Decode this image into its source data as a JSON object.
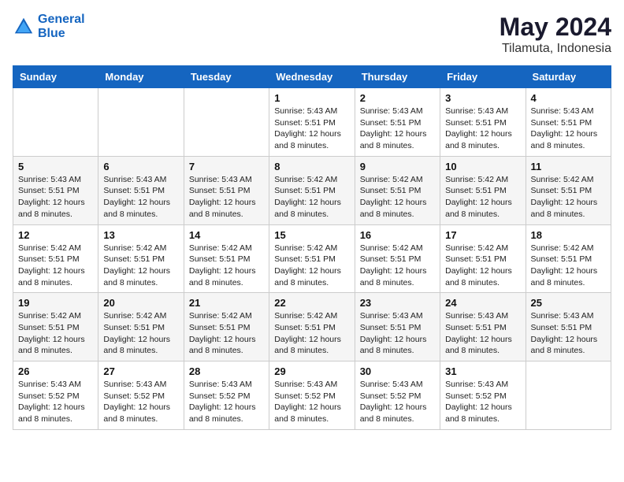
{
  "header": {
    "logo_line1": "General",
    "logo_line2": "Blue",
    "month": "May 2024",
    "location": "Tilamuta, Indonesia"
  },
  "weekdays": [
    "Sunday",
    "Monday",
    "Tuesday",
    "Wednesday",
    "Thursday",
    "Friday",
    "Saturday"
  ],
  "weeks": [
    [
      {
        "day": "",
        "info": ""
      },
      {
        "day": "",
        "info": ""
      },
      {
        "day": "",
        "info": ""
      },
      {
        "day": "1",
        "info": "Sunrise: 5:43 AM\nSunset: 5:51 PM\nDaylight: 12 hours\nand 8 minutes."
      },
      {
        "day": "2",
        "info": "Sunrise: 5:43 AM\nSunset: 5:51 PM\nDaylight: 12 hours\nand 8 minutes."
      },
      {
        "day": "3",
        "info": "Sunrise: 5:43 AM\nSunset: 5:51 PM\nDaylight: 12 hours\nand 8 minutes."
      },
      {
        "day": "4",
        "info": "Sunrise: 5:43 AM\nSunset: 5:51 PM\nDaylight: 12 hours\nand 8 minutes."
      }
    ],
    [
      {
        "day": "5",
        "info": "Sunrise: 5:43 AM\nSunset: 5:51 PM\nDaylight: 12 hours\nand 8 minutes."
      },
      {
        "day": "6",
        "info": "Sunrise: 5:43 AM\nSunset: 5:51 PM\nDaylight: 12 hours\nand 8 minutes."
      },
      {
        "day": "7",
        "info": "Sunrise: 5:43 AM\nSunset: 5:51 PM\nDaylight: 12 hours\nand 8 minutes."
      },
      {
        "day": "8",
        "info": "Sunrise: 5:42 AM\nSunset: 5:51 PM\nDaylight: 12 hours\nand 8 minutes."
      },
      {
        "day": "9",
        "info": "Sunrise: 5:42 AM\nSunset: 5:51 PM\nDaylight: 12 hours\nand 8 minutes."
      },
      {
        "day": "10",
        "info": "Sunrise: 5:42 AM\nSunset: 5:51 PM\nDaylight: 12 hours\nand 8 minutes."
      },
      {
        "day": "11",
        "info": "Sunrise: 5:42 AM\nSunset: 5:51 PM\nDaylight: 12 hours\nand 8 minutes."
      }
    ],
    [
      {
        "day": "12",
        "info": "Sunrise: 5:42 AM\nSunset: 5:51 PM\nDaylight: 12 hours\nand 8 minutes."
      },
      {
        "day": "13",
        "info": "Sunrise: 5:42 AM\nSunset: 5:51 PM\nDaylight: 12 hours\nand 8 minutes."
      },
      {
        "day": "14",
        "info": "Sunrise: 5:42 AM\nSunset: 5:51 PM\nDaylight: 12 hours\nand 8 minutes."
      },
      {
        "day": "15",
        "info": "Sunrise: 5:42 AM\nSunset: 5:51 PM\nDaylight: 12 hours\nand 8 minutes."
      },
      {
        "day": "16",
        "info": "Sunrise: 5:42 AM\nSunset: 5:51 PM\nDaylight: 12 hours\nand 8 minutes."
      },
      {
        "day": "17",
        "info": "Sunrise: 5:42 AM\nSunset: 5:51 PM\nDaylight: 12 hours\nand 8 minutes."
      },
      {
        "day": "18",
        "info": "Sunrise: 5:42 AM\nSunset: 5:51 PM\nDaylight: 12 hours\nand 8 minutes."
      }
    ],
    [
      {
        "day": "19",
        "info": "Sunrise: 5:42 AM\nSunset: 5:51 PM\nDaylight: 12 hours\nand 8 minutes."
      },
      {
        "day": "20",
        "info": "Sunrise: 5:42 AM\nSunset: 5:51 PM\nDaylight: 12 hours\nand 8 minutes."
      },
      {
        "day": "21",
        "info": "Sunrise: 5:42 AM\nSunset: 5:51 PM\nDaylight: 12 hours\nand 8 minutes."
      },
      {
        "day": "22",
        "info": "Sunrise: 5:42 AM\nSunset: 5:51 PM\nDaylight: 12 hours\nand 8 minutes."
      },
      {
        "day": "23",
        "info": "Sunrise: 5:43 AM\nSunset: 5:51 PM\nDaylight: 12 hours\nand 8 minutes."
      },
      {
        "day": "24",
        "info": "Sunrise: 5:43 AM\nSunset: 5:51 PM\nDaylight: 12 hours\nand 8 minutes."
      },
      {
        "day": "25",
        "info": "Sunrise: 5:43 AM\nSunset: 5:51 PM\nDaylight: 12 hours\nand 8 minutes."
      }
    ],
    [
      {
        "day": "26",
        "info": "Sunrise: 5:43 AM\nSunset: 5:52 PM\nDaylight: 12 hours\nand 8 minutes."
      },
      {
        "day": "27",
        "info": "Sunrise: 5:43 AM\nSunset: 5:52 PM\nDaylight: 12 hours\nand 8 minutes."
      },
      {
        "day": "28",
        "info": "Sunrise: 5:43 AM\nSunset: 5:52 PM\nDaylight: 12 hours\nand 8 minutes."
      },
      {
        "day": "29",
        "info": "Sunrise: 5:43 AM\nSunset: 5:52 PM\nDaylight: 12 hours\nand 8 minutes."
      },
      {
        "day": "30",
        "info": "Sunrise: 5:43 AM\nSunset: 5:52 PM\nDaylight: 12 hours\nand 8 minutes."
      },
      {
        "day": "31",
        "info": "Sunrise: 5:43 AM\nSunset: 5:52 PM\nDaylight: 12 hours\nand 8 minutes."
      },
      {
        "day": "",
        "info": ""
      }
    ]
  ]
}
